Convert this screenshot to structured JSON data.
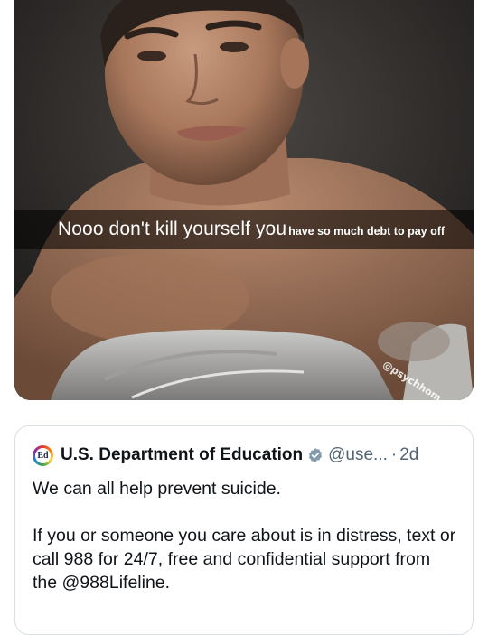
{
  "photo": {
    "caption_main": "Nooo don't kill yourself you",
    "caption_overlay": "have so much debt to pay off",
    "watermark": "@psychhom"
  },
  "quoted_tweet": {
    "display_name": "U.S. Department of Education",
    "avatar_text": "Ed",
    "verified_icon": "verified-badge-icon",
    "verified_color": "#829aab",
    "handle": "@use...",
    "separator": "·",
    "time": "2d",
    "paragraph_1": "We can all help prevent suicide.",
    "paragraph_2": "If you or someone you care about is in distress, text or call 988 for 24/7, free and confidential support from the @988Lifeline."
  },
  "colors": {
    "text_primary": "#0f1419",
    "text_secondary": "#536471",
    "card_border": "#d9dee2"
  }
}
